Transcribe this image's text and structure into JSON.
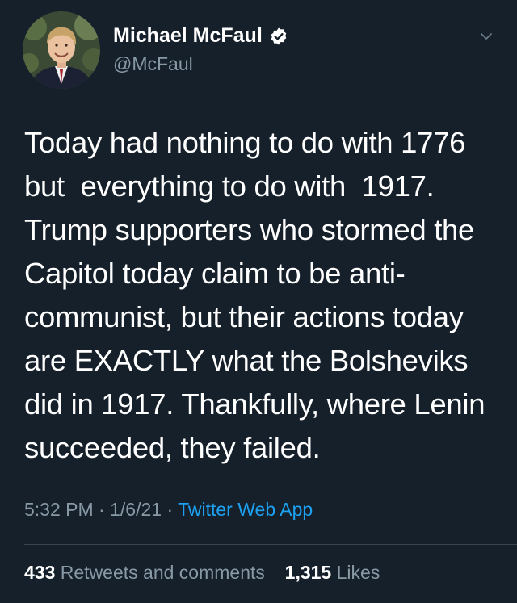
{
  "author": {
    "display_name": "Michael McFaul",
    "handle": "@McFaul",
    "verified": true
  },
  "tweet": {
    "lines": [
      "Today had nothing to do with 1776",
      "but  everything to do with  1917.",
      "Trump supporters who stormed the",
      "Capitol today claim to be anti-",
      "communist, but their actions today",
      "are EXACTLY what the Bolsheviks",
      "did in 1917. Thankfully, where Lenin",
      "succeeded, they failed."
    ],
    "time": "5:32 PM",
    "date": "1/6/21",
    "separator": "·",
    "source": "Twitter Web App"
  },
  "stats": {
    "retweets_count": "433",
    "retweets_label": "Retweets and comments",
    "likes_count": "1,315",
    "likes_label": "Likes"
  },
  "icons": {
    "verified": "verified-badge-icon",
    "more": "chevron-down-icon"
  },
  "colors": {
    "background": "#15202b",
    "text": "#ffffff",
    "secondary_text": "#8899a6",
    "link": "#1da1f2",
    "divider": "#38444d"
  }
}
